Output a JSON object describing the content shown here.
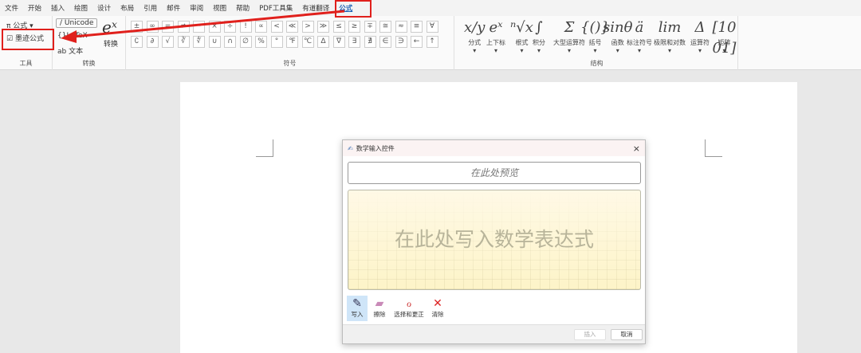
{
  "tabs": [
    "文件",
    "开始",
    "插入",
    "绘图",
    "设计",
    "布局",
    "引用",
    "邮件",
    "审阅",
    "视图",
    "帮助",
    "PDF工具集",
    "有道翻译",
    "公式"
  ],
  "tools_group": {
    "equation": "公式",
    "ink_equation": "墨迹公式",
    "label": "工具"
  },
  "convert_group": {
    "unicode": "Unicode",
    "latex": "{}LaTeX",
    "text": "文本",
    "convert": "转换",
    "label": "转换"
  },
  "symbols_group": {
    "label": "符号",
    "row1": [
      "±",
      "∞",
      "=",
      "≠",
      "~",
      "×",
      "÷",
      "!",
      "∝",
      "<",
      "≪",
      ">",
      "≫",
      "≤",
      "≥",
      "∓",
      "≅",
      "≈",
      "≡",
      "∀"
    ],
    "row2": [
      "∁",
      "∂",
      "√",
      "∛",
      "∜",
      "∪",
      "∩",
      "∅",
      "%",
      "°",
      "℉",
      "℃",
      "∆",
      "∇",
      "∃",
      "∄",
      "∈",
      "∋",
      "←",
      "↑"
    ]
  },
  "structures_group": {
    "label": "结构",
    "items": [
      {
        "glyph": "x/y",
        "label": "分式"
      },
      {
        "glyph": "eˣ",
        "label": "上下标"
      },
      {
        "glyph": "ⁿ√x",
        "label": "根式"
      },
      {
        "glyph": "∫",
        "label": "积分"
      },
      {
        "glyph": "Σ",
        "label": "大型运算符"
      },
      {
        "glyph": "{()}",
        "label": "括号"
      },
      {
        "glyph": "sinθ",
        "label": "函数"
      },
      {
        "glyph": "ä",
        "label": "标注符号"
      },
      {
        "glyph": "lim",
        "label": "极限和对数"
      },
      {
        "glyph": "Δ",
        "label": "运算符"
      },
      {
        "glyph": "[10 01]",
        "label": "矩阵"
      }
    ]
  },
  "dialog": {
    "title": "数学输入控件",
    "preview": "在此处预览",
    "write_hint": "在此处写入数学表达式",
    "tools": [
      {
        "label": "写入",
        "icon": "✎"
      },
      {
        "label": "擦除",
        "icon": "▰"
      },
      {
        "label": "选择和更正",
        "icon": "ℴ"
      },
      {
        "label": "清除",
        "icon": "✕"
      }
    ],
    "insert": "插入",
    "cancel": "取消"
  },
  "colors": {
    "accent": "#1a5fb4",
    "highlight": "#e0201c"
  }
}
